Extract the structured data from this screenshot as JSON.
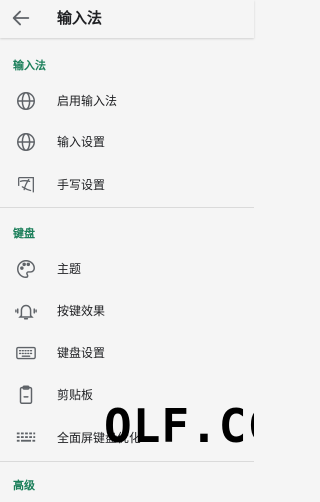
{
  "header": {
    "title": "输入法",
    "back_icon": "arrow-left-icon"
  },
  "sections": {
    "input_method": {
      "title": "输入法",
      "items": [
        {
          "label": "启用输入法",
          "icon": "globe-icon"
        },
        {
          "label": "输入设置",
          "icon": "globe-icon"
        },
        {
          "label": "手写设置",
          "icon": "handwriting-icon"
        }
      ]
    },
    "keyboard": {
      "title": "键盘",
      "items": [
        {
          "label": "主题",
          "icon": "palette-icon"
        },
        {
          "label": "按键效果",
          "icon": "bell-vibrate-icon"
        },
        {
          "label": "键盘设置",
          "icon": "keyboard-icon"
        },
        {
          "label": "剪贴板",
          "icon": "clipboard-icon"
        },
        {
          "label": "全面屏键盘优化",
          "icon": "keyboard-grid-icon"
        }
      ]
    },
    "advanced": {
      "title": "高级"
    }
  },
  "colors": {
    "section_accent": "#1b7f5a",
    "background": "#f5f5f5"
  },
  "watermark": {
    "text": "OLF.CC"
  }
}
